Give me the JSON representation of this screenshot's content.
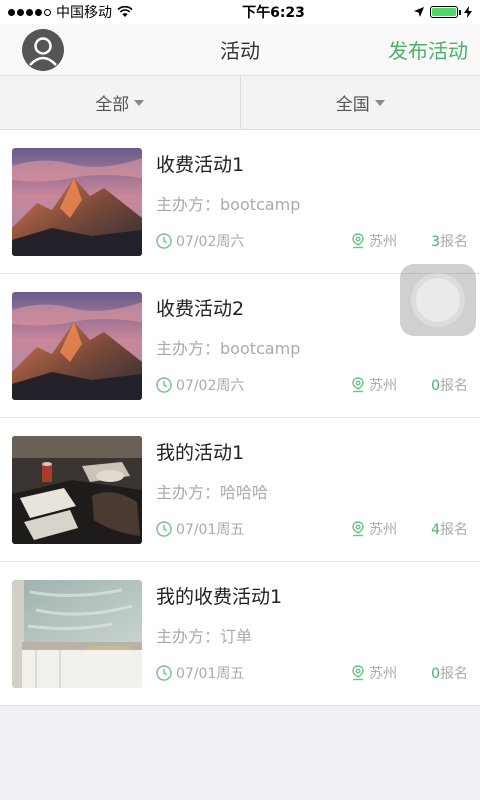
{
  "status_bar": {
    "carrier": "中国移动",
    "time": "下午6:23"
  },
  "nav": {
    "title": "活动",
    "action_label": "发布活动",
    "accent_color": "#4caf6a"
  },
  "filters": [
    {
      "label": "全部"
    },
    {
      "label": "全国"
    }
  ],
  "events": [
    {
      "title": "收费活动1",
      "organizer": "主办方：bootcamp",
      "date": "07/02周六",
      "location": "苏州",
      "count": "3",
      "count_suffix": "报名",
      "image": "mountain-photo"
    },
    {
      "title": "收费活动2",
      "organizer": "主办方：bootcamp",
      "date": "07/02周六",
      "location": "苏州",
      "count": "0",
      "count_suffix": "报名",
      "image": "mountain-photo"
    },
    {
      "title": "我的活动1",
      "organizer": "主办方：哈哈哈",
      "date": "07/01周五",
      "location": "苏州",
      "count": "4",
      "count_suffix": "报名",
      "image": "desk-photo"
    },
    {
      "title": "我的收费活动1",
      "organizer": "主办方：订单",
      "date": "07/01周五",
      "location": "苏州",
      "count": "0",
      "count_suffix": "报名",
      "image": "chalkboard-photo"
    }
  ]
}
